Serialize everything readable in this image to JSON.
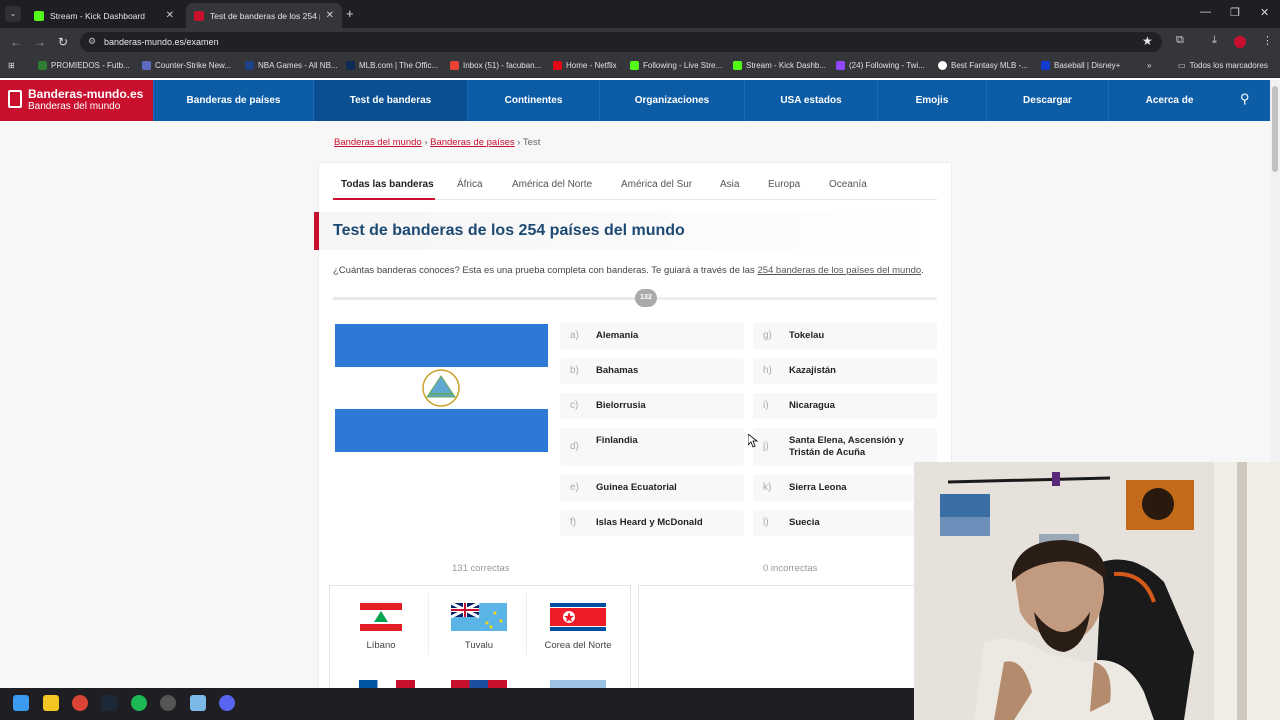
{
  "browser": {
    "tabs": [
      {
        "title": "Stream - Kick Dashboard",
        "active": false,
        "color": "#53fc18"
      },
      {
        "title": "Test de banderas de los 254 pa",
        "active": true,
        "color": "#c8102e"
      }
    ],
    "url": "banderas-mundo.es/examen",
    "bookmarks": [
      {
        "label": "PROMIEDOS - Futb...",
        "color": "#2e7d32"
      },
      {
        "label": "Counter-Strike New...",
        "color": "#5c6bc0"
      },
      {
        "label": "NBA Games - All NB...",
        "color": "#1d428a"
      },
      {
        "label": "MLB.com | The Offic...",
        "color": "#0d2b56"
      },
      {
        "label": "Inbox (51) - facuban...",
        "color": "#ea4335"
      },
      {
        "label": "Home - Netflix",
        "color": "#e50914"
      },
      {
        "label": "Following - Live Stre...",
        "color": "#53fc18"
      },
      {
        "label": "Stream - Kick Dashb...",
        "color": "#53fc18"
      },
      {
        "label": "(24) Following - Twi...",
        "color": "#9146ff"
      },
      {
        "label": "Best Fantasy MLB -...",
        "color": "#ffffff"
      },
      {
        "label": "Baseball | Disney+",
        "color": "#113ccf"
      }
    ],
    "all_bookmarks": "Todos los marcadores"
  },
  "site": {
    "logo_title": "Banderas-mundo.es",
    "logo_subtitle": "Banderas del mundo",
    "nav": [
      "Banderas de países",
      "Test de banderas",
      "Continentes",
      "Organizaciones",
      "USA estados",
      "Emojis",
      "Descargar",
      "Acerca de"
    ],
    "active_nav": 1
  },
  "breadcrumb": {
    "items": [
      "Banderas del mundo",
      "Banderas de países"
    ],
    "current": "Test"
  },
  "continent_tabs": [
    "Todas las banderas",
    "África",
    "América del Norte",
    "América del Sur",
    "Asia",
    "Europa",
    "Oceanía"
  ],
  "quiz": {
    "title": "Test de banderas de los 254 países del mundo",
    "intro_before": "¿Cuántas banderas conoces? Esta es una prueba completa con banderas. Te guiará a través de las ",
    "intro_link": "254 banderas de los países del mundo",
    "intro_after": ".",
    "question_number": "132",
    "progress": 0.52,
    "options_left": [
      {
        "letter": "a)",
        "name": "Alemania"
      },
      {
        "letter": "b)",
        "name": "Bahamas"
      },
      {
        "letter": "c)",
        "name": "Bielorrusia"
      },
      {
        "letter": "d)",
        "name": "Finlandia"
      },
      {
        "letter": "e)",
        "name": "Guinea Ecuatorial"
      },
      {
        "letter": "f)",
        "name": "Islas Heard y McDonald"
      }
    ],
    "options_right": [
      {
        "letter": "g)",
        "name": "Tokelau"
      },
      {
        "letter": "h)",
        "name": "Kazajistán"
      },
      {
        "letter": "i)",
        "name": "Nicaragua"
      },
      {
        "letter": "j)",
        "name": "Santa Elena, Ascensión y Tristán de Acuña"
      },
      {
        "letter": "k)",
        "name": "Sierra Leona"
      },
      {
        "letter": "l)",
        "name": "Suecia"
      }
    ],
    "correct_label": "131 correctas",
    "incorrect_label": "0 incorrectas",
    "answered": [
      "Líbano",
      "Tuvalu",
      "Corea del Norte"
    ]
  },
  "colors": {
    "brand_red": "#c8102e",
    "brand_blue": "#0d5ca6",
    "title_blue": "#1d4a73"
  }
}
